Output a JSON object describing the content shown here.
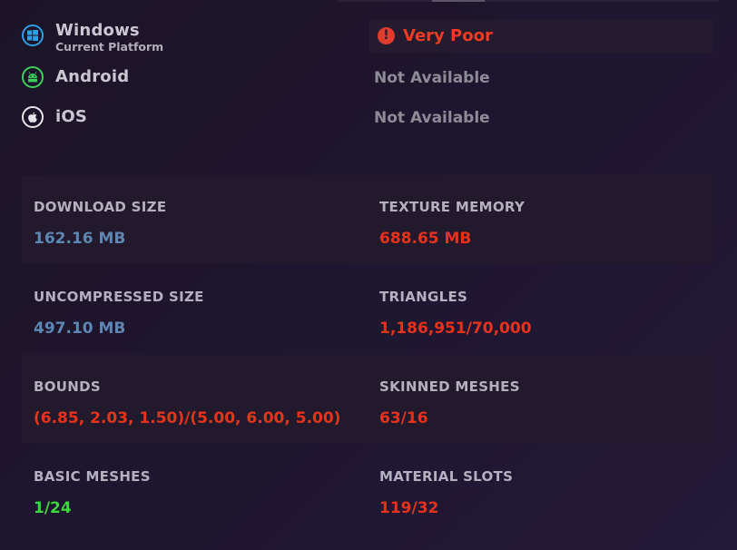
{
  "platforms": [
    {
      "name": "Windows",
      "subtitle": "Current Platform",
      "status": "Very Poor",
      "icon": "windows-icon"
    },
    {
      "name": "Android",
      "status": "Not Available",
      "icon": "android-icon"
    },
    {
      "name": "iOS",
      "status": "Not Available",
      "icon": "apple-icon"
    }
  ],
  "stats": {
    "download_size": {
      "label": "DOWNLOAD SIZE",
      "value": "162.16 MB"
    },
    "texture_memory": {
      "label": "TEXTURE MEMORY",
      "value": "688.65 MB"
    },
    "uncompressed_size": {
      "label": "UNCOMPRESSED SIZE",
      "value": "497.10 MB"
    },
    "triangles": {
      "label": "TRIANGLES",
      "value": "1,186,951/70,000"
    },
    "bounds": {
      "label": "BOUNDS",
      "value": "(6.85, 2.03, 1.50)/(5.00, 6.00, 5.00)"
    },
    "skinned_meshes": {
      "label": "SKINNED MESHES",
      "value": "63/16"
    },
    "basic_meshes": {
      "label": "BASIC MESHES",
      "value": "1/24"
    },
    "material_slots": {
      "label": "MATERIAL SLOTS",
      "value": "119/32"
    }
  },
  "colors": {
    "ok_value": "#5e86b3",
    "bad_value": "#e8321c",
    "good_value": "#3dd63d",
    "alert": "#e03c2e",
    "windows_brand": "#2f9ee6",
    "android_brand": "#3ecf5b",
    "apple_brand": "#e6e6ea"
  }
}
